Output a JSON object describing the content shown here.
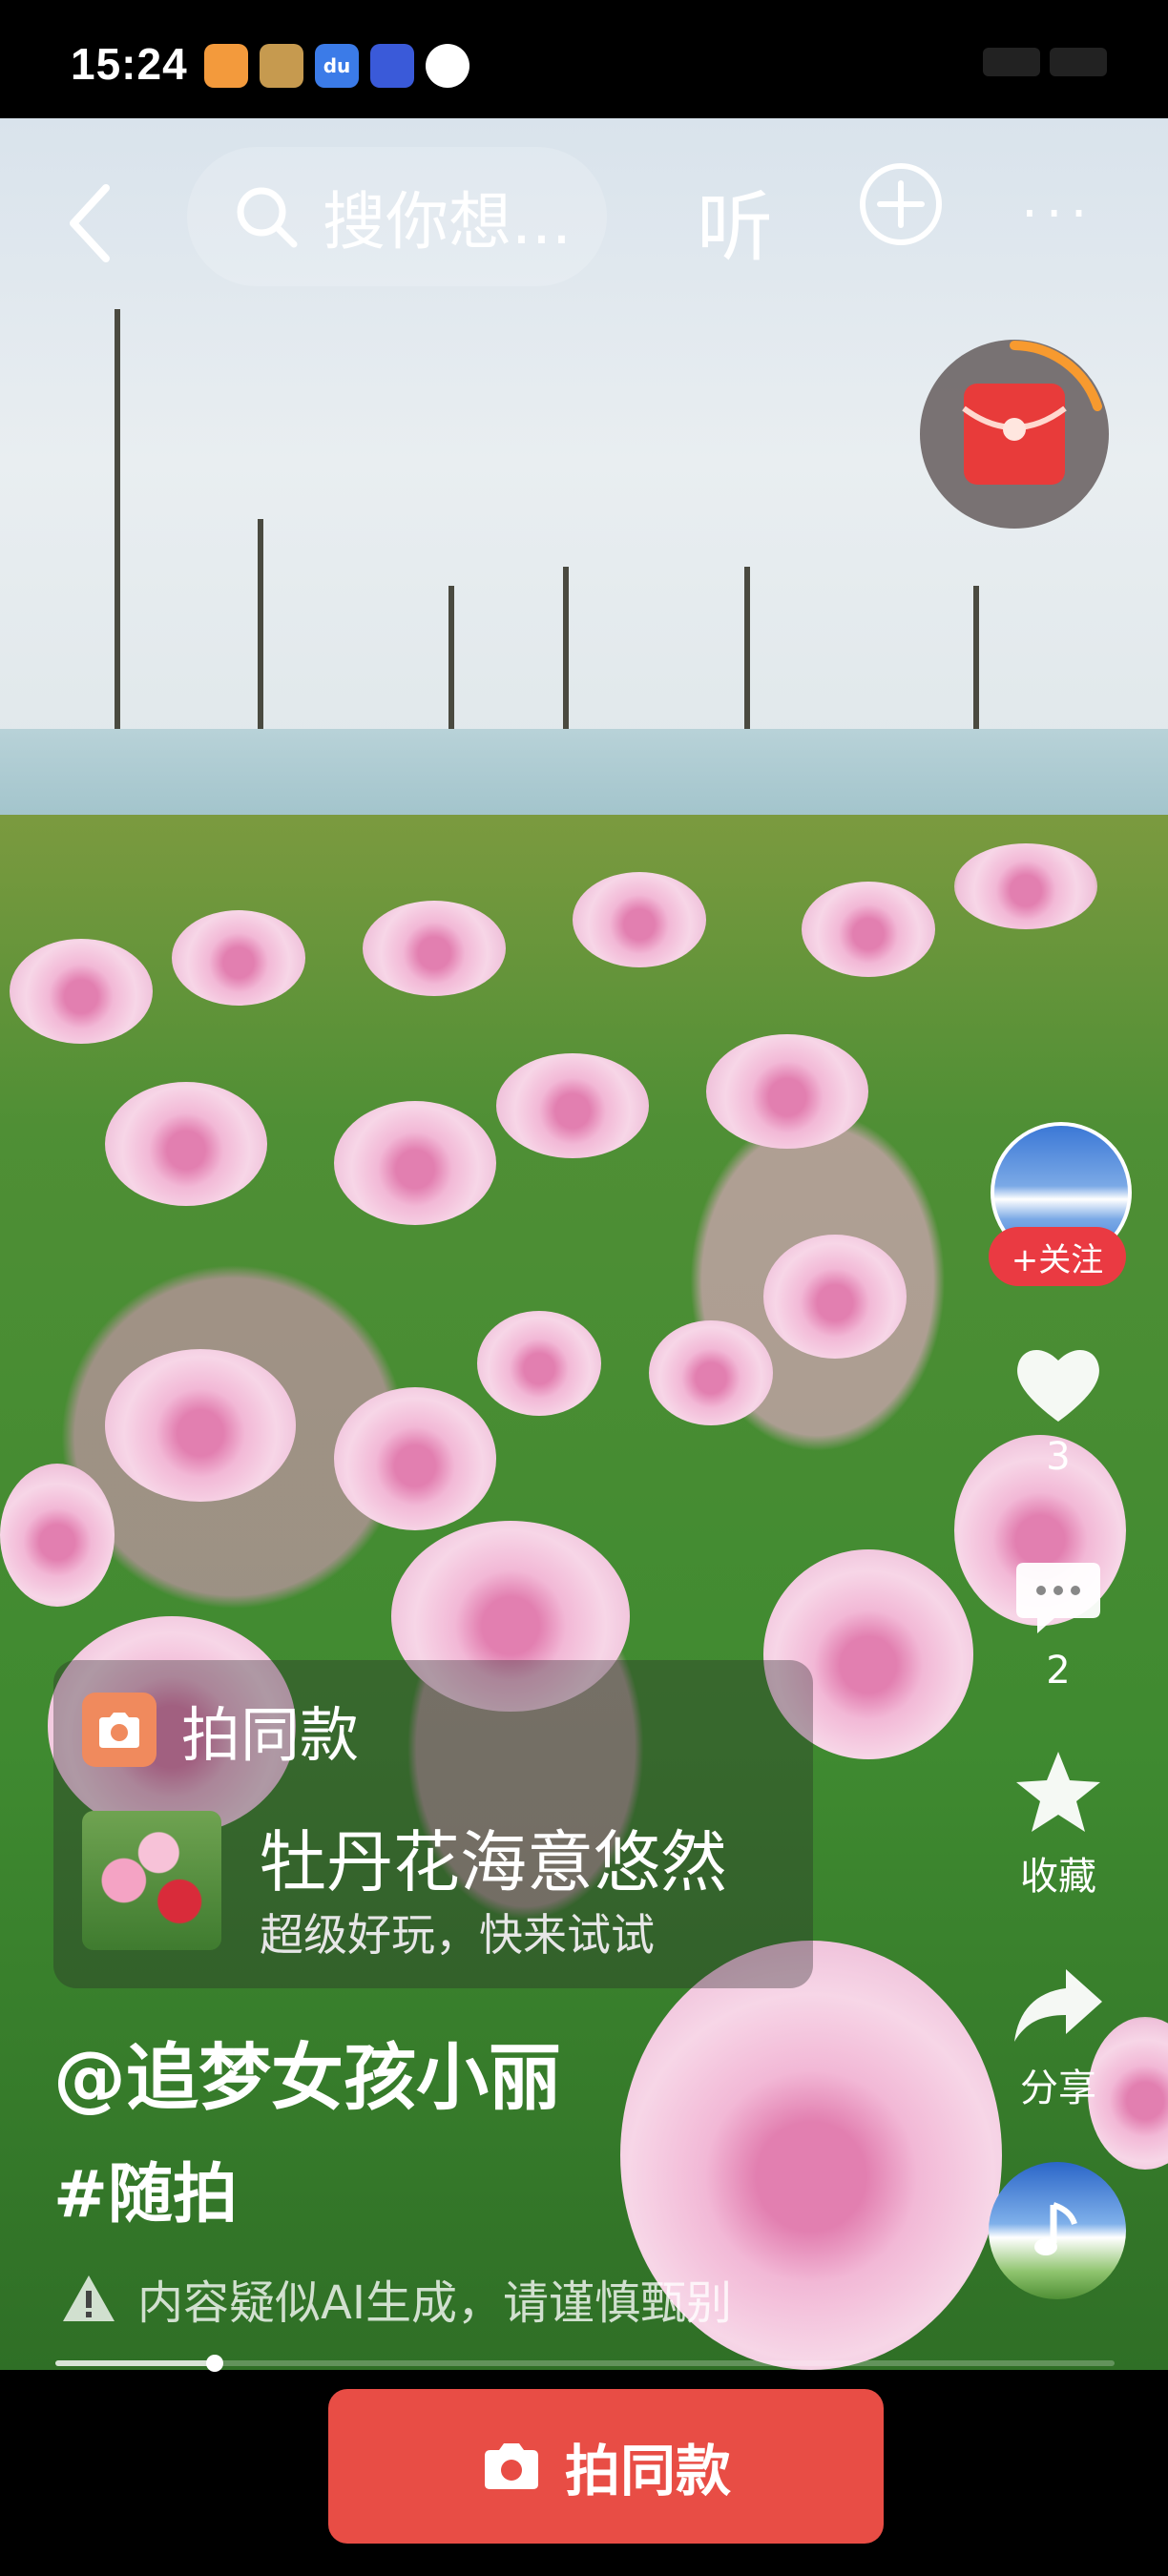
{
  "status_bar": {
    "time": "15:24",
    "apps": [
      {
        "icon": "heart-app-icon",
        "color": "#f39a3c",
        "label": ""
      },
      {
        "icon": "game-app-icon",
        "color": "#c69a4f",
        "label": ""
      },
      {
        "icon": "baidu-app-icon",
        "color": "#3b7be8",
        "label": "du"
      },
      {
        "icon": "app-market-icon",
        "color": "#3a5ad9",
        "label": ""
      },
      {
        "icon": "audio-app-icon",
        "color": "#ffffff",
        "label": ""
      }
    ]
  },
  "top_bar": {
    "search_text": "搜你想...",
    "listen_label": "听"
  },
  "sidebar": {
    "follow_label": "+关注",
    "like_count": "3",
    "comment_count": "2",
    "favorite_label": "收藏",
    "share_label": "分享"
  },
  "template_card": {
    "header": "拍同款",
    "title": "牡丹花海意悠然",
    "subtitle": "超级好玩，快来试试"
  },
  "post": {
    "author": "@追梦女孩小丽",
    "tag": "#随拍",
    "ai_notice": "内容疑似AI生成，请谨慎甄别"
  },
  "progress": {
    "fraction": 0.15
  },
  "bottom_button": {
    "label": "拍同款"
  },
  "colors": {
    "accent": "#e84d45",
    "follow": "#ea3a42",
    "template_badge": "#f08a5d"
  }
}
